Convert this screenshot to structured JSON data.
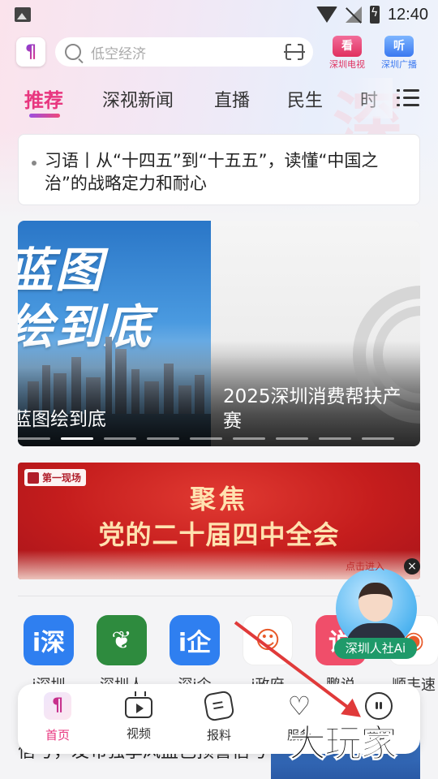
{
  "status_bar": {
    "time": "12:40"
  },
  "header": {
    "search_placeholder": "低空经济",
    "channel_tv": {
      "badge": "看",
      "label": "深圳电视"
    },
    "channel_radio": {
      "badge": "听",
      "label": "深圳广播"
    }
  },
  "tabs": [
    "推荐",
    "深视新闻",
    "直播",
    "民生",
    "时"
  ],
  "headline": "习语丨从“十四五”到“十五五”，读懂“中国之治”的战略定力和耐心",
  "carousel": {
    "slide1_big_line1": "蓝图",
    "slide1_big_line2": "绘到底",
    "slide1_caption": "蓝图绘到底",
    "slide2_caption": "2025深圳消费帮扶产赛",
    "dot_count": 9,
    "active_dot": 1
  },
  "banner": {
    "tag": "第一现场",
    "title_line1": "聚焦",
    "title_line2": "党的二十届四中全会",
    "more": "点击进入"
  },
  "apps": [
    {
      "name": "i深圳",
      "glyph": "i深",
      "color": "#2f7ff0"
    },
    {
      "name": "深圳人",
      "glyph": "❦",
      "color": "#2e8b3e"
    },
    {
      "name": "深i企",
      "glyph": "i企",
      "color": "#2f7ff0"
    },
    {
      "name": "i政府",
      "glyph": "☺",
      "color": "#ffffff"
    },
    {
      "name": "鹏说",
      "glyph": "说",
      "color": "#f04e6a"
    },
    {
      "name": "顺丰速",
      "glyph": "◉",
      "color": "#ffffff"
    }
  ],
  "ai_assistant": {
    "label": "深圳人社Ai",
    "close": "×"
  },
  "peek_news": "信号，发布强季风蓝色预警信号",
  "bottom_nav": [
    {
      "label": "首页",
      "active": true
    },
    {
      "label": "视频",
      "active": false
    },
    {
      "label": "报料",
      "active": false
    },
    {
      "label": "服务",
      "active": false
    },
    {
      "label": "我的",
      "active": false
    }
  ],
  "watermark": "大玩家",
  "colors": {
    "accent": "#e8367f",
    "tv": "#e0305f",
    "radio": "#3a78f0",
    "banner_red": "#c51d1d",
    "ai_green": "#1f9a6a"
  }
}
